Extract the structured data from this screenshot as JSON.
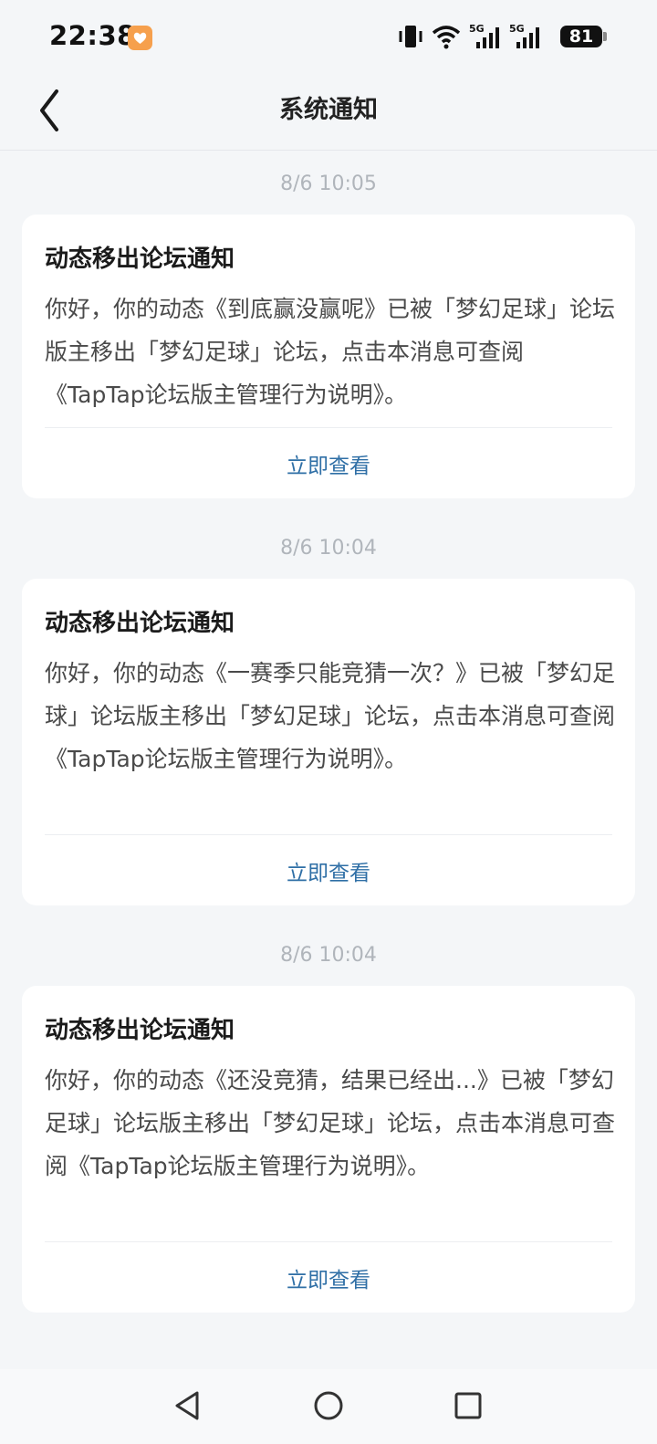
{
  "status_bar": {
    "time": "22:38",
    "battery": "81",
    "network_label": "5G",
    "icons": [
      "app-badge-icon",
      "vibrate-icon",
      "wifi-icon",
      "signal-icon",
      "battery-icon"
    ]
  },
  "header": {
    "title": "系统通知",
    "back_icon": "chevron-left-icon"
  },
  "notifications": [
    {
      "time": "8/6  10:05",
      "title": "动态移出论坛通知",
      "body": "你好，你的动态《到底赢没赢呢》已被「梦幻足球」论坛版主移出「梦幻足球」论坛，点击本消息可查阅《TapTap论坛版主管理行为说明》。",
      "action": "立即查看"
    },
    {
      "time": "8/6  10:04",
      "title": "动态移出论坛通知",
      "body": "你好，你的动态《一赛季只能竞猜一次？》已被「梦幻足球」论坛版主移出「梦幻足球」论坛，点击本消息可查阅《TapTap论坛版主管理行为说明》。",
      "action": "立即查看"
    },
    {
      "time": "8/6  10:04",
      "title": "动态移出论坛通知",
      "body": "你好，你的动态《还没竞猜，结果已经出...》已被「梦幻足球」论坛版主移出「梦幻足球」论坛，点击本消息可查阅《TapTap论坛版主管理行为说明》。",
      "action": "立即查看"
    }
  ],
  "nav_bar": {
    "icons": [
      "back-triangle-icon",
      "home-circle-icon",
      "recents-square-icon"
    ]
  },
  "colors": {
    "background": "#f4f6f8",
    "card": "#ffffff",
    "action": "#2f6fa6",
    "timestamp": "#b0b5bb"
  }
}
